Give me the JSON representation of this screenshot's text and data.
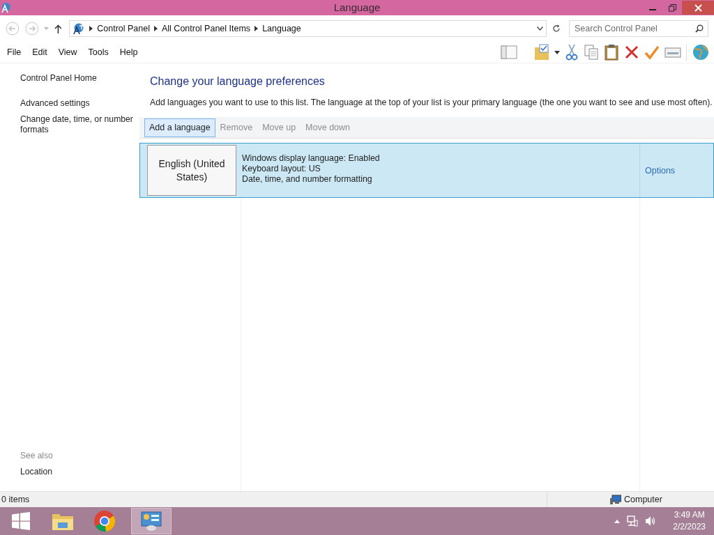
{
  "window": {
    "title": "Language"
  },
  "address_bar": {
    "breadcrumbs": [
      "Control Panel",
      "All Control Panel Items",
      "Language"
    ]
  },
  "search": {
    "placeholder": "Search Control Panel"
  },
  "menu": [
    "File",
    "Edit",
    "View",
    "Tools",
    "Help"
  ],
  "sidebar": {
    "links": [
      "Control Panel Home",
      "Advanced settings",
      "Change date, time, or number formats"
    ],
    "see_also_heading": "See also",
    "see_also": [
      "Location"
    ]
  },
  "main": {
    "heading": "Change your language preferences",
    "description": "Add languages you want to use to this list. The language at the top of your list is your primary language (the one you want to see and use most often).",
    "toolbar": [
      {
        "label": "Add a language",
        "disabled": false,
        "focused": true
      },
      {
        "label": "Remove",
        "disabled": true,
        "focused": false
      },
      {
        "label": "Move up",
        "disabled": true,
        "focused": false
      },
      {
        "label": "Move down",
        "disabled": true,
        "focused": false
      }
    ],
    "languages": [
      {
        "name": "English (United States)",
        "details": [
          "Windows display language: Enabled",
          "Keyboard layout: US",
          "Date, time, and number formatting"
        ],
        "options": "Options",
        "selected": true
      }
    ]
  },
  "status_bar": {
    "items": "0 items",
    "zone": "Computer"
  },
  "taskbar": {
    "time": "3:49 AM",
    "date": "2/2/2023"
  }
}
